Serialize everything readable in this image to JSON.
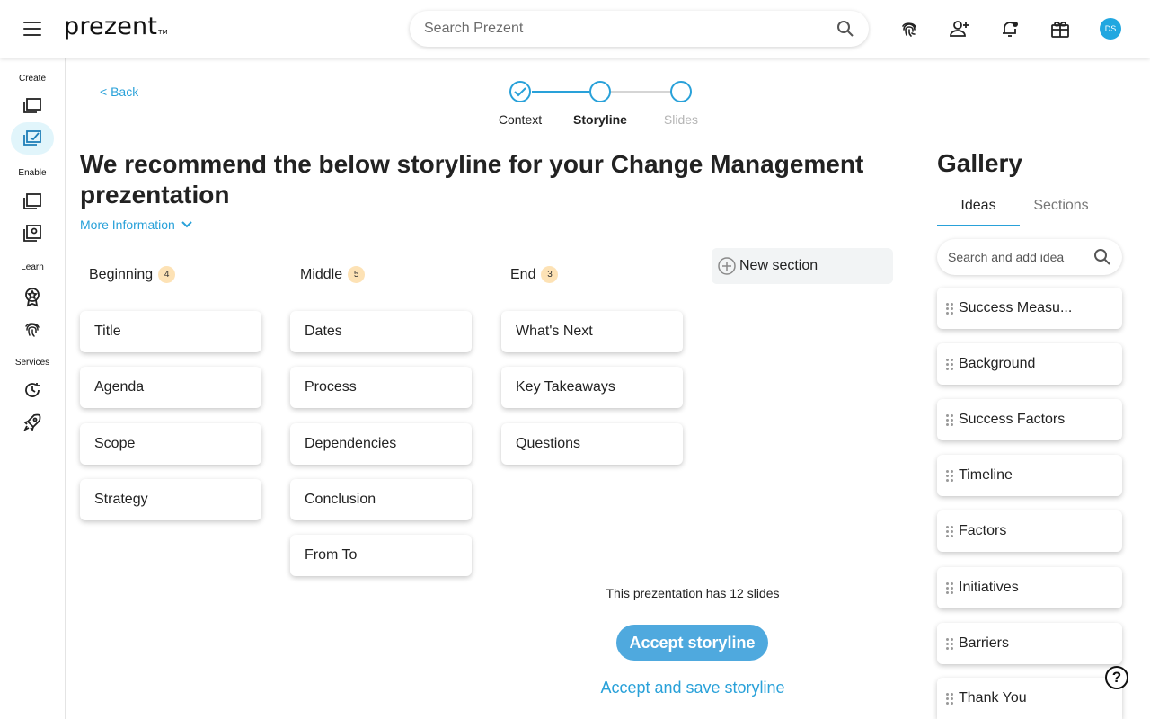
{
  "header": {
    "logo": "prezent",
    "logo_tm": "TM",
    "search_placeholder": "Search Prezent",
    "avatar_initials": "DS"
  },
  "sidenav": {
    "groups": [
      {
        "label": "Create"
      },
      {
        "label": "Enable"
      },
      {
        "label": "Learn"
      },
      {
        "label": "Services"
      }
    ]
  },
  "back_label": "< Back",
  "stepper": {
    "steps": [
      {
        "label": "Context",
        "state": "done"
      },
      {
        "label": "Storyline",
        "state": "active"
      },
      {
        "label": "Slides",
        "state": "pending"
      }
    ]
  },
  "title": "We recommend the below storyline for your Change Management prezentation",
  "more_info": "More Information",
  "columns": [
    {
      "name": "Beginning",
      "count": "4",
      "cards": [
        "Title",
        "Agenda",
        "Scope",
        "Strategy"
      ]
    },
    {
      "name": "Middle",
      "count": "5",
      "cards": [
        "Dates",
        "Process",
        "Dependencies",
        "Conclusion",
        "From To"
      ]
    },
    {
      "name": "End",
      "count": "3",
      "cards": [
        "What's Next",
        "Key Takeaways",
        "Questions"
      ]
    }
  ],
  "new_section": "New section",
  "slides_info": "This prezentation has 12 slides",
  "accept_label": "Accept storyline",
  "accept_save_label": "Accept and save storyline",
  "gallery": {
    "title": "Gallery",
    "tabs": [
      "Ideas",
      "Sections"
    ],
    "search_placeholder": "Search and add idea",
    "ideas": [
      "Success Measu...",
      "Background",
      "Success Factors",
      "Timeline",
      "Factors",
      "Initiatives",
      "Barriers",
      "Thank You"
    ]
  },
  "help": "?",
  "colors": {
    "accent": "#29a1d9",
    "button": "#4fa9de",
    "badge": "#fde2b5",
    "active_nav": "#e1f5fb"
  }
}
